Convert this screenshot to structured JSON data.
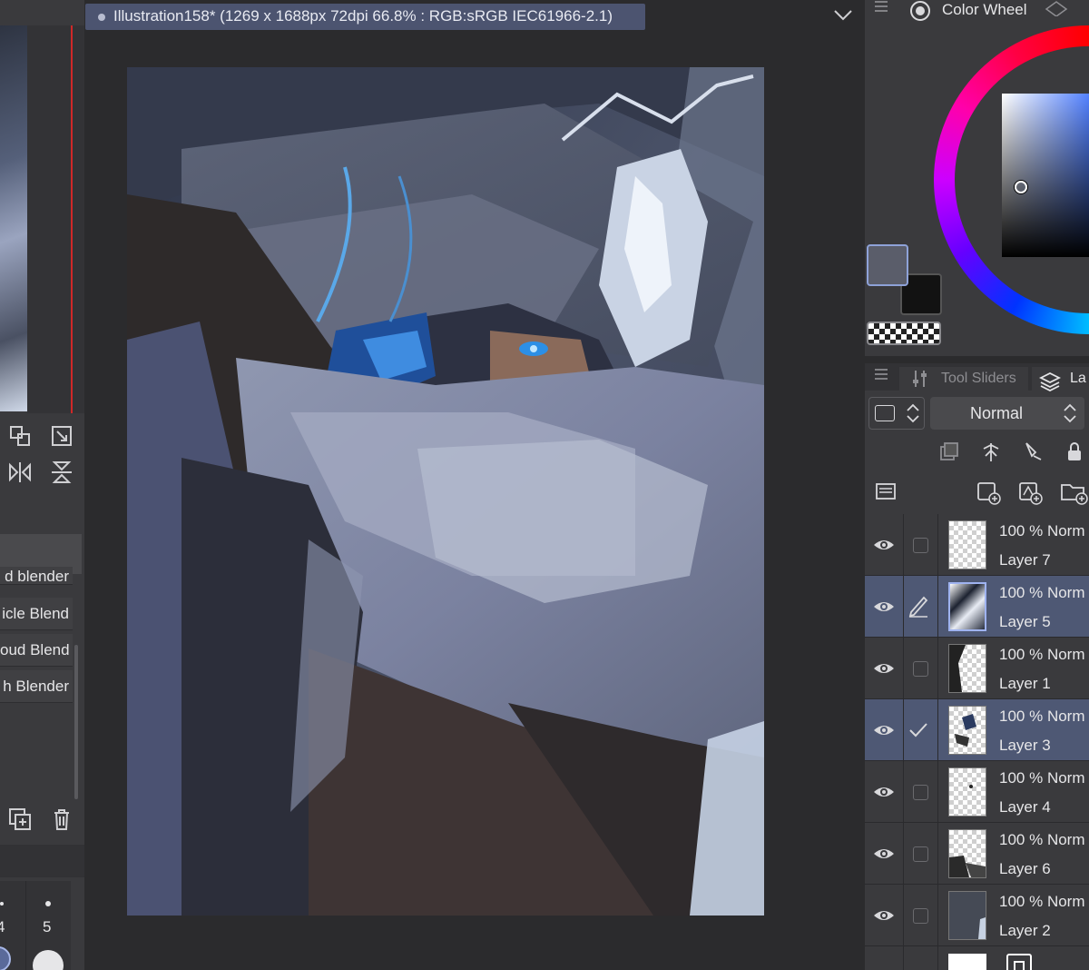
{
  "document": {
    "title": "Illustration158* (1269 x 1688px 72dpi 66.8% : RGB:sRGB IEC61966-2.1)"
  },
  "brushes": {
    "items": [
      {
        "label": "d blender"
      },
      {
        "label": "icle Blend"
      },
      {
        "label": "oud Blend"
      },
      {
        "label": "h Blender"
      }
    ]
  },
  "brush_sizes": {
    "labels": [
      "4",
      "5"
    ]
  },
  "color_panel": {
    "title": "Color Wheel",
    "main_color": "#5a5d6a",
    "sub_color": "#121212"
  },
  "layer_panel": {
    "tabs": [
      {
        "label": "Tool Sliders"
      },
      {
        "label": "La"
      }
    ],
    "blend_mode": "Normal",
    "layers": [
      {
        "opacity": "100 %",
        "mode": "Norm",
        "name": "Layer 7",
        "selected": false,
        "marker": "none"
      },
      {
        "opacity": "100 %",
        "mode": "Norm",
        "name": "Layer 5",
        "selected": true,
        "marker": "pen"
      },
      {
        "opacity": "100 %",
        "mode": "Norm",
        "name": "Layer 1",
        "selected": false,
        "marker": "none"
      },
      {
        "opacity": "100 %",
        "mode": "Norm",
        "name": "Layer 3",
        "selected": true,
        "marker": "check"
      },
      {
        "opacity": "100 %",
        "mode": "Norm",
        "name": "Layer 4",
        "selected": false,
        "marker": "none"
      },
      {
        "opacity": "100 %",
        "mode": "Norm",
        "name": "Layer 6",
        "selected": false,
        "marker": "none"
      },
      {
        "opacity": "100 %",
        "mode": "Norm",
        "name": "Layer 2",
        "selected": false,
        "marker": "none"
      }
    ]
  },
  "colors": {
    "accent": "#4e5874",
    "tab": "#4c5470",
    "panel": "#3a3a3d",
    "background": "#2b2b2d"
  }
}
